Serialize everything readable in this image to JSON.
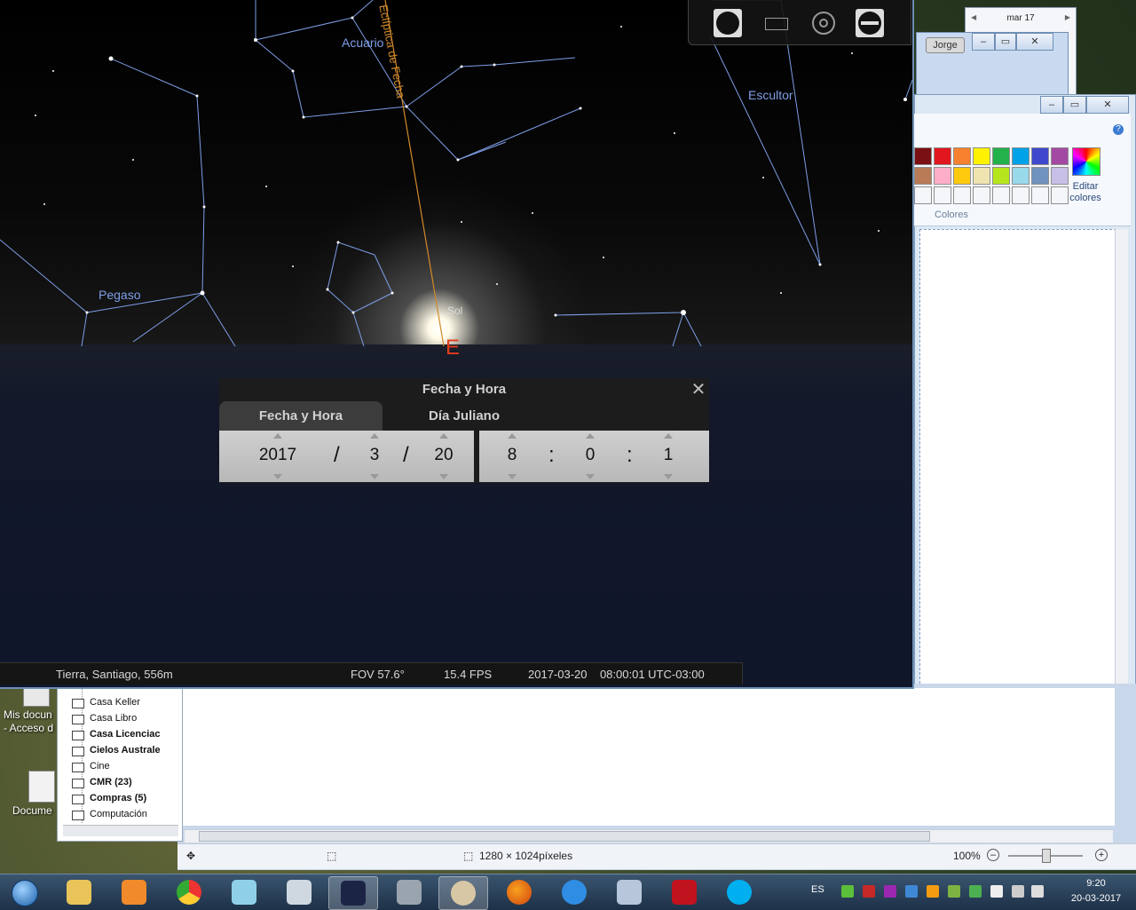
{
  "desktop": {
    "icons": [
      {
        "label": "Mis docun\n- Acceso d"
      },
      {
        "label": "Docume"
      }
    ]
  },
  "calendar": {
    "month_label": "mar 17",
    "prev": "◀",
    "next": "▶"
  },
  "background_window": {
    "user_button": "Jorge"
  },
  "paint": {
    "edit_colors_label": "Editar\ncolores",
    "colors_label": "Colores",
    "help_icon": "?",
    "palette_row1": [
      "#7a0f14",
      "#e2161f",
      "#f7812e",
      "#fef200",
      "#23b14c",
      "#00a2e8",
      "#3f48cc",
      "#a349a4"
    ],
    "palette_row2": [
      "#b97a57",
      "#ffaec9",
      "#ffc90e",
      "#efe4b0",
      "#b5e61d",
      "#99d9ea",
      "#7092be",
      "#c8bfe7"
    ],
    "status": {
      "dimensions": "1280 × 1024píxeles",
      "zoom": "100%"
    }
  },
  "mail_folders": [
    {
      "label": "Casa Keller",
      "bold": false
    },
    {
      "label": "Casa Libro",
      "bold": false
    },
    {
      "label": "Casa Licenciac",
      "bold": true
    },
    {
      "label": "Cielos Australe",
      "bold": true
    },
    {
      "label": "Cine",
      "bold": false
    },
    {
      "label": "CMR (23)",
      "bold": true
    },
    {
      "label": "Compras (5)",
      "bold": true
    },
    {
      "label": "Computación",
      "bold": false
    }
  ],
  "stellarium": {
    "labels": {
      "acuario": "Acuario",
      "escultor": "Escultor",
      "pegaso": "Pegaso",
      "sol": "Sol",
      "ecliptica": "Eclíptica de Fecha",
      "cardinal_e": "E"
    },
    "colors": {
      "constellation": "#7e9ee6",
      "ecliptic": "#d28a2a",
      "cardinal": "#e43c1c"
    },
    "dialog": {
      "title": "Fecha y Hora",
      "tabs": [
        "Fecha y Hora",
        "Día Juliano"
      ],
      "date": {
        "year": "2017",
        "month": "3",
        "day": "20"
      },
      "time": {
        "hour": "8",
        "minute": "0",
        "second": "1"
      },
      "date_sep": "/",
      "time_sep": ":"
    },
    "status": {
      "location": "Tierra, Santiago, 556m",
      "fov": "FOV 57.6°",
      "fps": "15.4 FPS",
      "datetime": "2017-03-20    08:00:01 UTC-03:00"
    }
  },
  "taskbar": {
    "language": "ES",
    "clock_time": "9:20",
    "clock_date": "20-03-2017"
  }
}
